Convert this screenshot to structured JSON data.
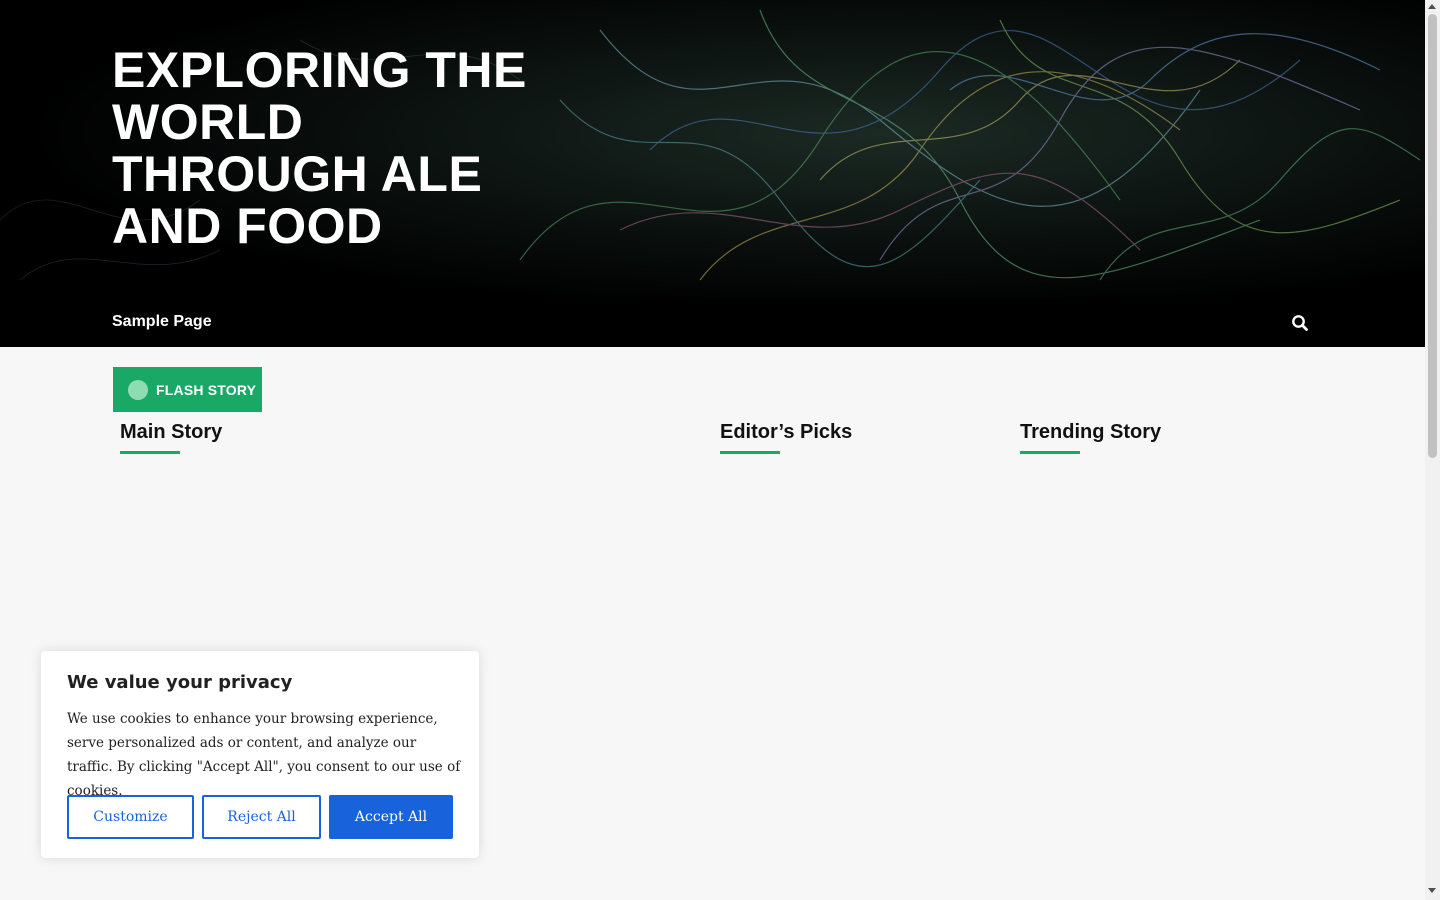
{
  "header": {
    "site_title": "EXPLORING THE WORLD THROUGH ALE AND FOOD"
  },
  "nav": {
    "items": [
      {
        "label": "Sample Page"
      }
    ],
    "search_icon": "search-icon"
  },
  "flash": {
    "label": "FLASH STORY"
  },
  "sections": {
    "main": "Main Story",
    "editors": "Editor’s Picks",
    "trending": "Trending Story"
  },
  "cookie_banner": {
    "title": "We value your privacy",
    "text": "We use cookies to enhance your browsing experience, serve personalized ads or content, and analyze our traffic. By clicking \"Accept All\", you consent to our use of cookies.",
    "customize_label": "Customize",
    "reject_label": "Reject All",
    "accept_label": "Accept All"
  },
  "colors": {
    "accent_green": "#1aa866",
    "cookie_blue": "#1863dc",
    "header_bg": "#000000",
    "page_bg": "#f7f7f7"
  }
}
